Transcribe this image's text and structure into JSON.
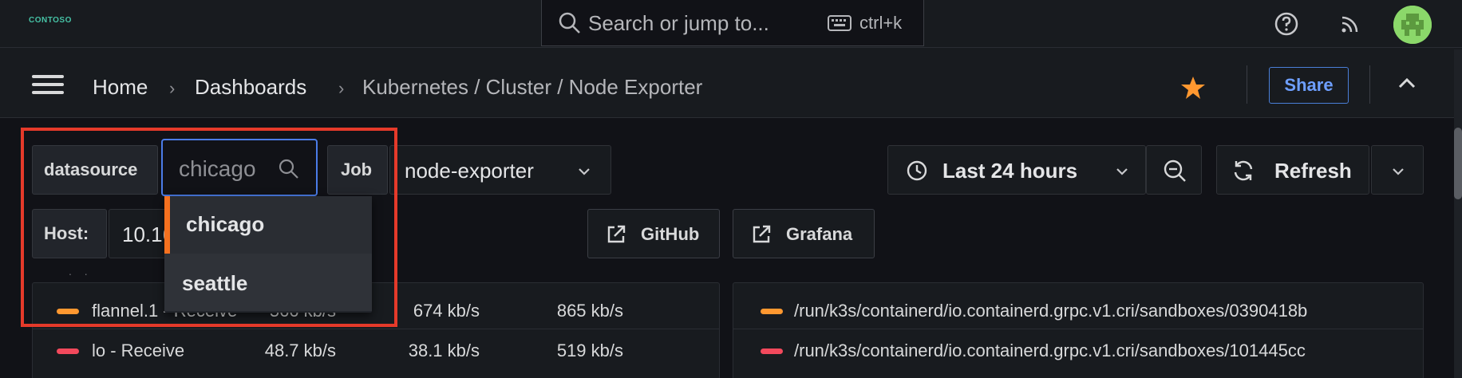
{
  "topbar": {
    "logo_text": "CONTOSO",
    "search_placeholder": "Search or jump to...",
    "shortcut": "ctrl+k"
  },
  "breadcrumb": {
    "home": "Home",
    "sep": "›",
    "dashboards": "Dashboards",
    "current": "Kubernetes / Cluster / Node Exporter"
  },
  "actions": {
    "share": "Share"
  },
  "variables": {
    "datasource_label": "datasource",
    "datasource_value": "chicago",
    "job_label": "Job",
    "job_value": "node-exporter",
    "host_label": "Host:",
    "host_value": "10.16",
    "options": [
      "chicago",
      "seattle"
    ]
  },
  "links": {
    "github": "GitHub",
    "grafana": "Grafana"
  },
  "time": {
    "range": "Last 24 hours",
    "refresh": "Refresh"
  },
  "panel_left": {
    "rows": [
      {
        "name": "flannel.1 - Receive",
        "v1": "566 kb/s",
        "v2": "674 kb/s",
        "v3": "865 kb/s",
        "color": "#ff9830"
      },
      {
        "name": "lo - Receive",
        "v1": "48.7 kb/s",
        "v2": "38.1 kb/s",
        "v3": "519 kb/s",
        "color": "#f2495c"
      }
    ]
  },
  "panel_right": {
    "rows": [
      {
        "name": "/run/k3s/containerd/io.containerd.grpc.v1.cri/sandboxes/0390418b",
        "color": "#ff9830"
      },
      {
        "name": "/run/k3s/containerd/io.containerd.grpc.v1.cri/sandboxes/101445cc",
        "color": "#f2495c"
      }
    ]
  },
  "colors": {
    "accent": "#f5711f",
    "focus": "#4b7ce8",
    "highlight": "#e53a2a",
    "star": "#ff9830"
  },
  "icons": [
    "search-icon",
    "keyboard-icon",
    "help-icon",
    "rss-icon",
    "avatar",
    "menu-icon",
    "star-icon",
    "chevron-up-icon",
    "clock-icon",
    "zoom-out-icon",
    "refresh-icon",
    "external-link-icon",
    "chevron-down-icon"
  ]
}
